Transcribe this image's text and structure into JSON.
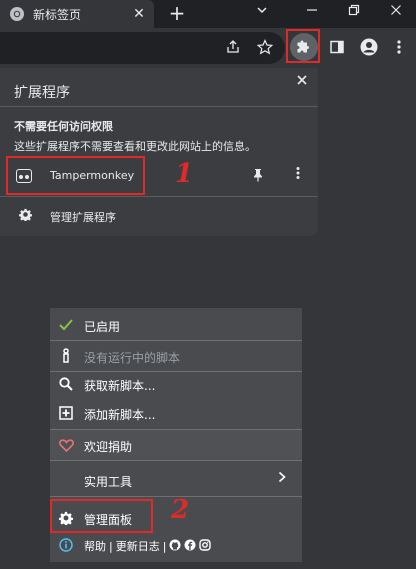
{
  "browser": {
    "tab_title": "新标签页",
    "tab_close": "✕",
    "new_tab": "+",
    "window_controls": [
      "chevron-down",
      "minimize",
      "restore",
      "close"
    ]
  },
  "toolbar": {
    "icons": [
      "share-icon",
      "star-icon",
      "extensions-icon",
      "side-panel-icon",
      "profile-icon",
      "menu-icon"
    ]
  },
  "extensions_panel": {
    "title": "扩展程序",
    "permission_heading": "不需要任何访问权限",
    "permission_desc": "这些扩展程序不需要查看和更改此网站上的信息。",
    "extension_name": "Tampermonkey",
    "manage_label": "管理扩展程序",
    "annotation_1": "1"
  },
  "tm_menu": {
    "items": [
      {
        "label": "已启用",
        "icon": "check-icon"
      },
      {
        "label": "没有运行中的脚本",
        "icon": "script-icon"
      },
      {
        "label": "获取新脚本...",
        "icon": "search-icon"
      },
      {
        "label": "添加新脚本...",
        "icon": "plus-box-icon"
      },
      {
        "label": "欢迎捐助",
        "icon": "heart-icon"
      },
      {
        "label": "实用工具",
        "icon": ""
      },
      {
        "label": "管理面板",
        "icon": "gear-icon"
      }
    ],
    "footer_help": "帮助",
    "footer_sep": "|",
    "footer_changelog": "更新日志",
    "footer_sep2": "|",
    "annotation_2": "2"
  },
  "colors": {
    "annotation_red": "#e02a2a",
    "check_green": "#8bc34a",
    "heart_red": "#e57373",
    "info_blue": "#4fc3f7"
  }
}
